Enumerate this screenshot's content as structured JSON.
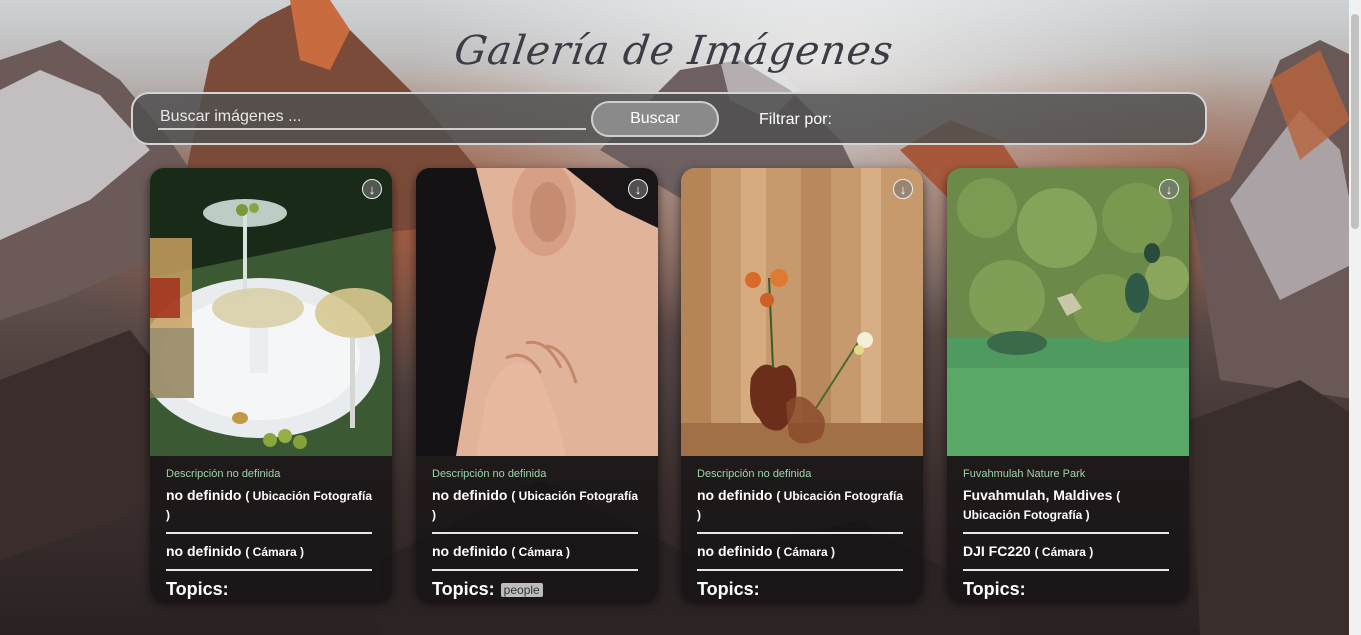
{
  "page": {
    "title": "Galería de Imágenes"
  },
  "search": {
    "placeholder": "Buscar imágenes ...",
    "value": "",
    "button_label": "Buscar",
    "filter_label": "Filtrar por:"
  },
  "cards": [
    {
      "description": "Descripción no definida",
      "location": "no definido",
      "location_suffix": "( Ubicación Fotografía )",
      "camera": "no definido",
      "camera_suffix": "( Cámara )",
      "topics_label": "Topics:",
      "topics": []
    },
    {
      "description": "Descripción no definida",
      "location": "no definido",
      "location_suffix": "( Ubicación Fotografía )",
      "camera": "no definido",
      "camera_suffix": "( Cámara )",
      "topics_label": "Topics:",
      "topics": [
        "people"
      ]
    },
    {
      "description": "Descripción no definida",
      "location": "no definido",
      "location_suffix": "( Ubicación Fotografía )",
      "camera": "no definido",
      "camera_suffix": "( Cámara )",
      "topics_label": "Topics:",
      "topics": []
    },
    {
      "description": "Fuvahmulah Nature Park",
      "location": "Fuvahmulah, Maldives",
      "location_suffix": "( Ubicación Fotografía )",
      "camera": "DJI FC220",
      "camera_suffix": "( Cámara )",
      "topics_label": "Topics:",
      "topics": []
    }
  ],
  "icons": {
    "download": "download-icon"
  },
  "colors": {
    "description_text": "#9fd4a8",
    "searchbar_bg": "#505050",
    "title": "#3c3c46"
  }
}
